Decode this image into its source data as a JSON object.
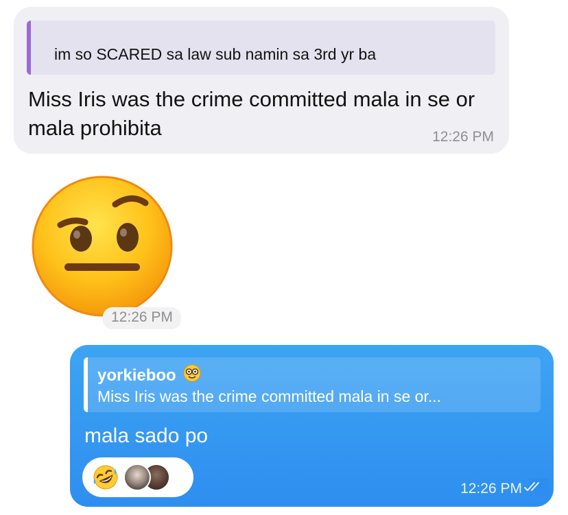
{
  "incoming": {
    "quote_text": "im so SCARED sa law sub namin sa 3rd yr ba",
    "message_text": "Miss Iris was the crime committed mala in se or mala prohibita",
    "time": "12:26 PM"
  },
  "sticker": {
    "emoji": "face-with-raised-eyebrow",
    "time": "12:26 PM"
  },
  "outgoing": {
    "reply_name": "yorkieboo",
    "reply_name_emoji": "nerd-face",
    "reply_text": "Miss Iris was the crime committed mala in se or...",
    "message_text": "mala sado po",
    "reaction_emoji": "rolling-on-the-floor-laughing",
    "reaction_count_avatars": 2,
    "time": "12:26 PM",
    "read_status": "read-double-check"
  },
  "colors": {
    "incoming_bubble": "#efeff4",
    "incoming_quote_bg": "#e5e2ef",
    "incoming_quote_bar": "#9c6ad6",
    "outgoing_bubble": "#2e8ef0",
    "timestamp_gray": "#8e8e93"
  }
}
